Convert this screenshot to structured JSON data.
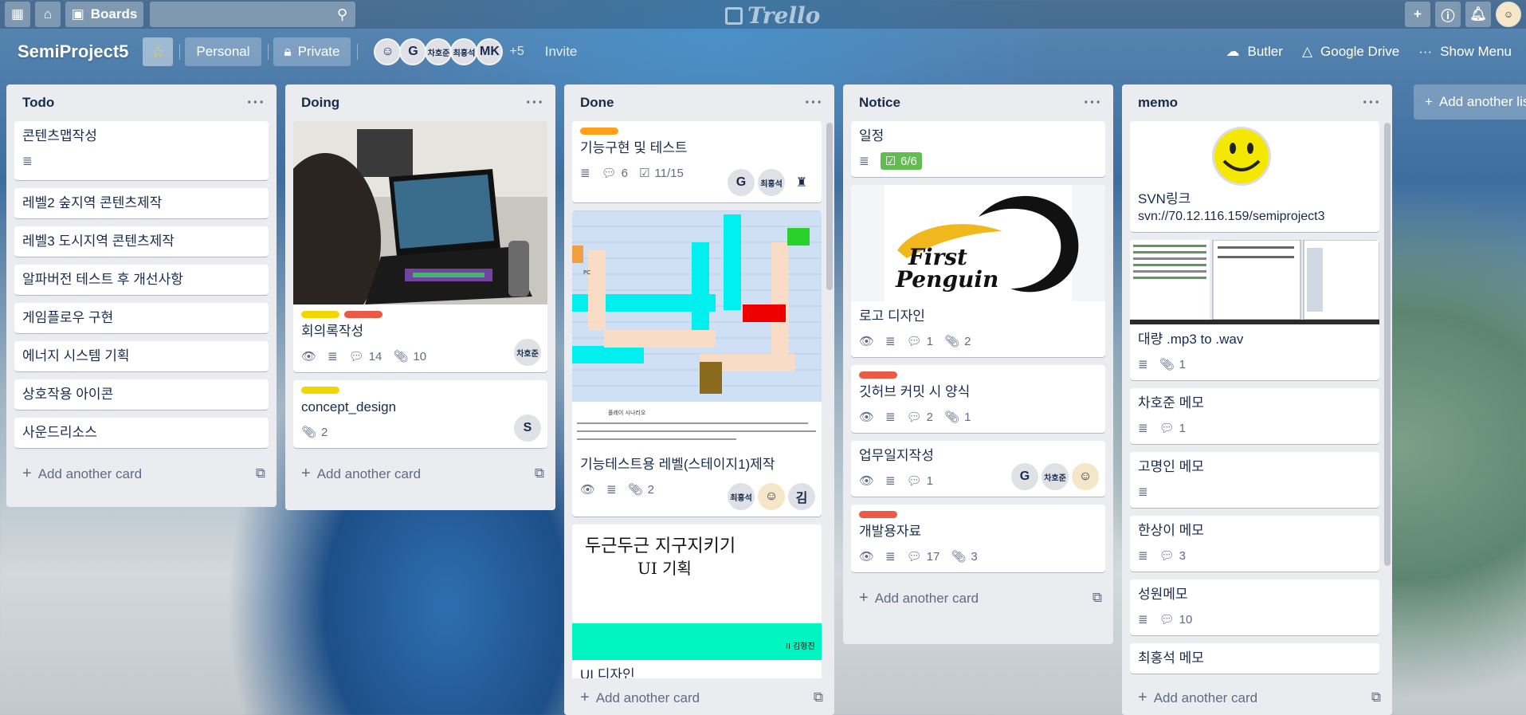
{
  "topbar": {
    "boards_label": "Boards",
    "logo_text": "Trello"
  },
  "board": {
    "title": "SemiProject5",
    "visibility_team": "Personal",
    "visibility_privacy": "Private",
    "members": [
      "G",
      "차호준",
      "최홍석",
      "MK"
    ],
    "members_more": "+5",
    "invite_label": "Invite",
    "butler_label": "Butler",
    "gdrive_label": "Google Drive",
    "show_menu_label": "Show Menu",
    "add_list_label": "Add another list"
  },
  "add_card_label": "Add another card",
  "lists": {
    "todo": {
      "title": "Todo",
      "cards": [
        "콘텐츠맵작성",
        "레벨2 숲지역 콘텐츠제작",
        "레벨3 도시지역 콘텐츠제작",
        "알파버전 테스트 후 개선사항",
        "게임플로우 구현",
        "에너지 시스템 기획",
        "상호작용 아이콘",
        "사운드리소스"
      ]
    },
    "doing": {
      "title": "Doing",
      "card1": {
        "title": "회의록작성",
        "comments": "14",
        "attachments": "10",
        "member": "차호준"
      },
      "card2": {
        "title": "concept_design",
        "attachments": "2",
        "member": "S"
      }
    },
    "done": {
      "title": "Done",
      "card1": {
        "title": "기능구현 및 테스트",
        "comments": "6",
        "checklist": "11/15",
        "member1": "G",
        "member2": "최홍석"
      },
      "card2": {
        "title": "기능테스트용 레벨(스테이지1)제작",
        "attachments": "2",
        "member1": "최홍석",
        "member3": "김",
        "cover_caption": "플레이 시나리오",
        "cover_pc": "PC"
      },
      "card3": {
        "title": "UI 디자인",
        "cover_line1": "두근두근 지구지키기",
        "cover_line2": "UI 기획",
        "cover_author": "II 김형진"
      }
    },
    "notice": {
      "title": "Notice",
      "card1": {
        "title": "일정",
        "checklist": "6/6"
      },
      "card2": {
        "title": "로고 디자인",
        "comments": "1",
        "attachments": "2",
        "logo_line1": "First",
        "logo_line2": "Penguin"
      },
      "card3": {
        "title": "깃허브 커밋 시 양식",
        "comments": "2",
        "attachments": "1"
      },
      "card4": {
        "title": "업무일지작성",
        "comments": "1",
        "member1": "G",
        "member2": "차호준"
      },
      "card5": {
        "title": "개발용자료",
        "comments": "17",
        "attachments": "3"
      }
    },
    "memo": {
      "title": "memo",
      "card1": {
        "title": "SVN링크",
        "url": "svn://70.12.116.159/semiproject3"
      },
      "card2": {
        "title": "대량 .mp3 to .wav",
        "attachments": "1"
      },
      "card3": {
        "title": "차호준 메모",
        "comments": "1"
      },
      "card4": {
        "title": "고명인 메모"
      },
      "card5": {
        "title": "한상이 메모",
        "comments": "3"
      },
      "card6": {
        "title": "성원메모",
        "comments": "10"
      },
      "card7": {
        "title": "최홍석 메모"
      }
    }
  },
  "colors": {
    "yellow": "#f2d600",
    "red": "#eb5a46",
    "orange": "#ff9f1a",
    "green": "#61bd4f"
  }
}
